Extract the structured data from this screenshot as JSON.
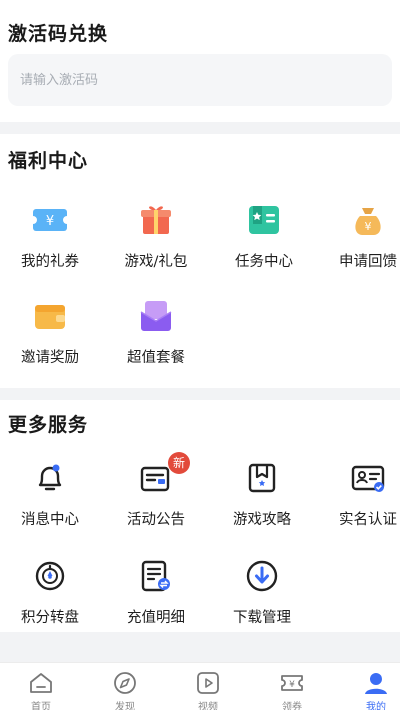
{
  "redeem": {
    "title": "激活码兑换",
    "placeholder": "请输入激活码"
  },
  "welfare": {
    "title": "福利中心",
    "items": [
      {
        "label": "我的礼券",
        "icon": "coupon-icon"
      },
      {
        "label": "游戏/礼包",
        "icon": "gift-box-icon"
      },
      {
        "label": "任务中心",
        "icon": "task-book-icon"
      },
      {
        "label": "申请回馈",
        "icon": "money-bag-icon"
      },
      {
        "label": "邀请奖励",
        "icon": "wallet-icon"
      },
      {
        "label": "超值套餐",
        "icon": "package-icon"
      }
    ]
  },
  "services": {
    "title": "更多服务",
    "badge_new": "新",
    "items": [
      {
        "label": "消息中心",
        "icon": "bell-icon"
      },
      {
        "label": "活动公告",
        "icon": "announcement-icon"
      },
      {
        "label": "游戏攻略",
        "icon": "guide-bookmark-icon"
      },
      {
        "label": "实名认证",
        "icon": "id-card-icon"
      },
      {
        "label": "积分转盘",
        "icon": "points-wheel-icon"
      },
      {
        "label": "充值明细",
        "icon": "recharge-detail-icon"
      },
      {
        "label": "下载管理",
        "icon": "download-icon"
      }
    ]
  },
  "nav": {
    "items": [
      {
        "label": "首页",
        "icon": "home-icon"
      },
      {
        "label": "发现",
        "icon": "compass-icon"
      },
      {
        "label": "视频",
        "icon": "video-icon"
      },
      {
        "label": "领券",
        "icon": "ticket-icon"
      },
      {
        "label": "我的",
        "icon": "user-icon",
        "active": true
      }
    ]
  },
  "colors": {
    "accent": "#3a6cf4",
    "badge": "#e24a3b"
  }
}
